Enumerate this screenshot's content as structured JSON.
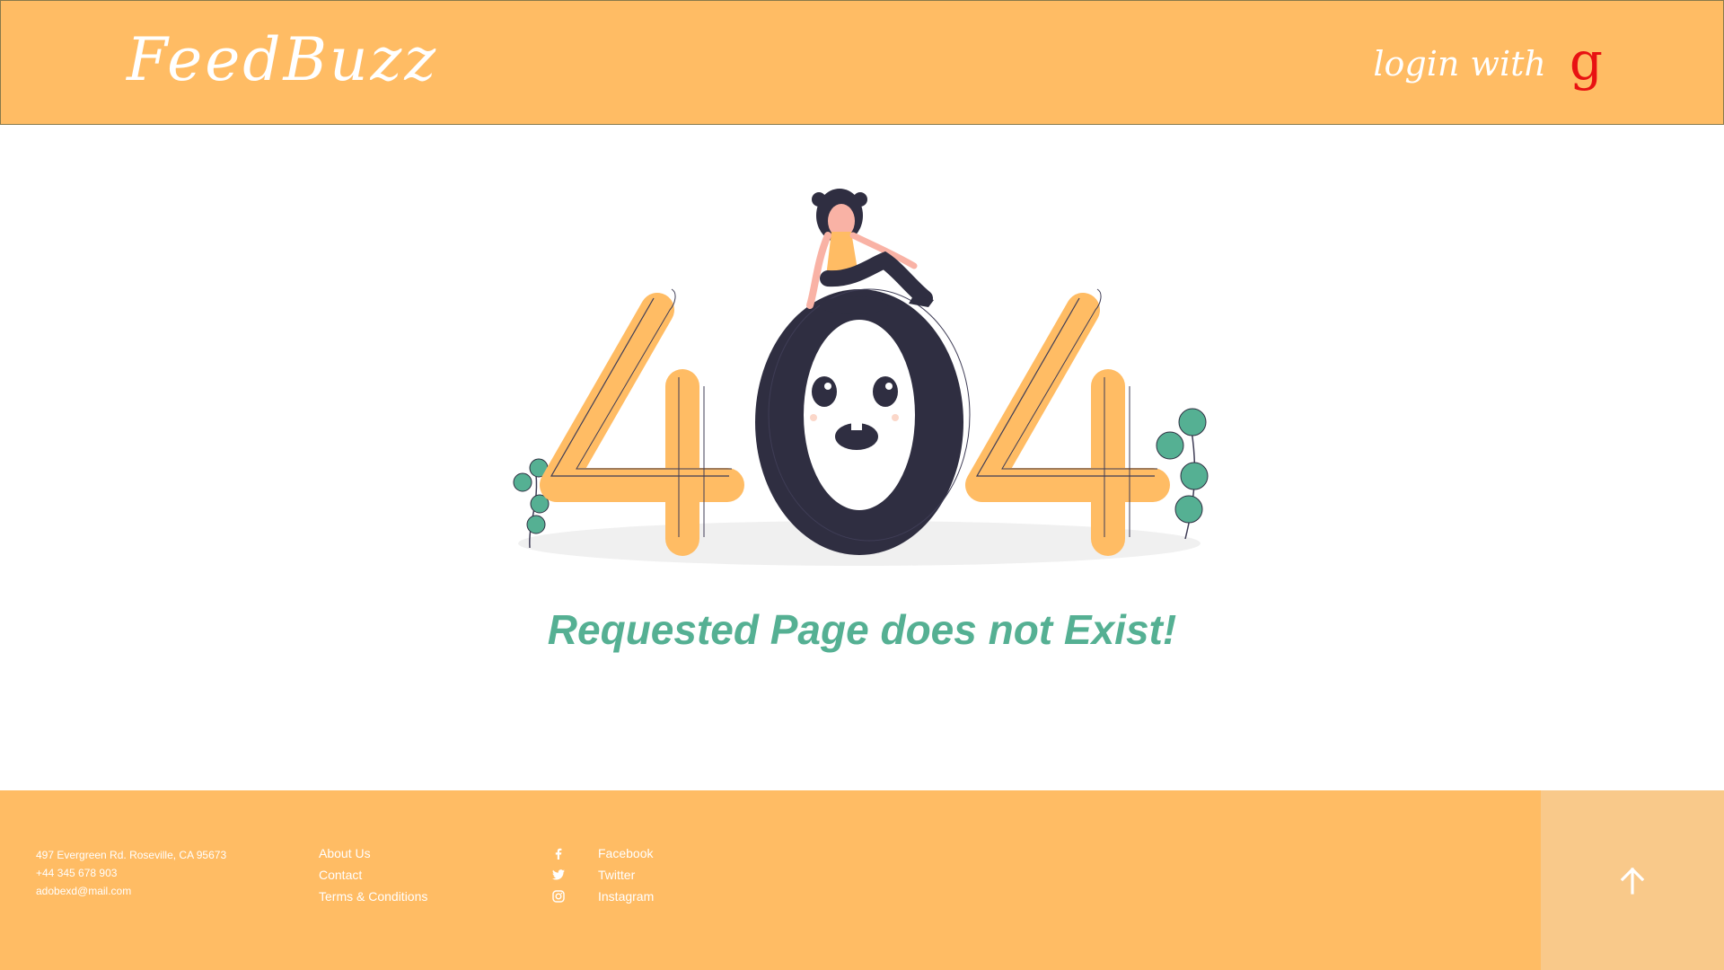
{
  "header": {
    "logo": "FeedBuzz",
    "login_label": "login with",
    "google_glyph": "g"
  },
  "main": {
    "illustration": {
      "digits": [
        "4",
        "0",
        "4"
      ],
      "description_icon": "404-illustration"
    },
    "message": "Requested Page does not Exist!"
  },
  "footer": {
    "address": [
      "497 Evergreen Rd. Roseville, CA 95673",
      "+44 345 678 903",
      "adobexd@mail.com"
    ],
    "links": [
      "About Us",
      "Contact",
      "Terms & Conditions"
    ],
    "social": [
      {
        "label": "Facebook",
        "icon": "facebook-icon"
      },
      {
        "label": "Twitter",
        "icon": "twitter-icon"
      },
      {
        "label": "Instagram",
        "icon": "instagram-icon"
      }
    ],
    "scroll_top_icon": "arrow-up-icon"
  },
  "colors": {
    "brand": "#FFBC64",
    "brand_light": "#F9C98A",
    "accent_green": "#55B093",
    "dark": "#2F2E41",
    "google_red": "#E81212"
  }
}
